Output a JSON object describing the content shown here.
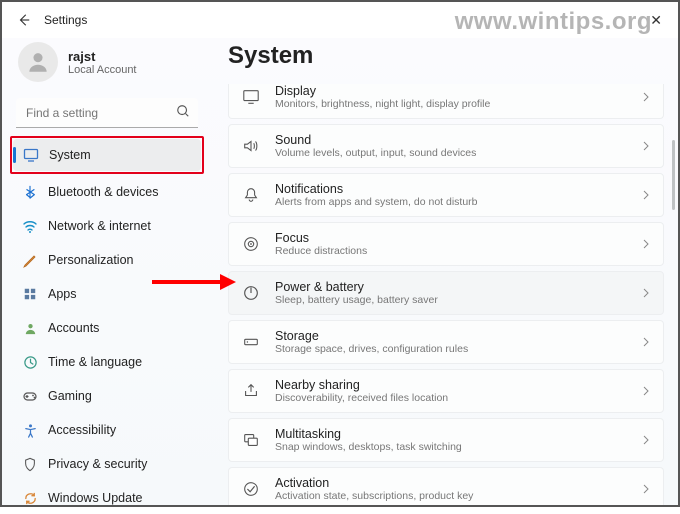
{
  "window": {
    "app_title": "Settings",
    "close_label": "✕"
  },
  "watermark": "www.wintips.org",
  "user": {
    "name": "rajst",
    "sub": "Local Account"
  },
  "search": {
    "placeholder": "Find a setting"
  },
  "sidebar": {
    "items": [
      {
        "label": "System"
      },
      {
        "label": "Bluetooth & devices"
      },
      {
        "label": "Network & internet"
      },
      {
        "label": "Personalization"
      },
      {
        "label": "Apps"
      },
      {
        "label": "Accounts"
      },
      {
        "label": "Time & language"
      },
      {
        "label": "Gaming"
      },
      {
        "label": "Accessibility"
      },
      {
        "label": "Privacy & security"
      },
      {
        "label": "Windows Update"
      }
    ]
  },
  "page": {
    "title": "System"
  },
  "cards": [
    {
      "title": "Display",
      "sub": "Monitors, brightness, night light, display profile"
    },
    {
      "title": "Sound",
      "sub": "Volume levels, output, input, sound devices"
    },
    {
      "title": "Notifications",
      "sub": "Alerts from apps and system, do not disturb"
    },
    {
      "title": "Focus",
      "sub": "Reduce distractions"
    },
    {
      "title": "Power & battery",
      "sub": "Sleep, battery usage, battery saver"
    },
    {
      "title": "Storage",
      "sub": "Storage space, drives, configuration rules"
    },
    {
      "title": "Nearby sharing",
      "sub": "Discoverability, received files location"
    },
    {
      "title": "Multitasking",
      "sub": "Snap windows, desktops, task switching"
    },
    {
      "title": "Activation",
      "sub": "Activation state, subscriptions, product key"
    }
  ]
}
